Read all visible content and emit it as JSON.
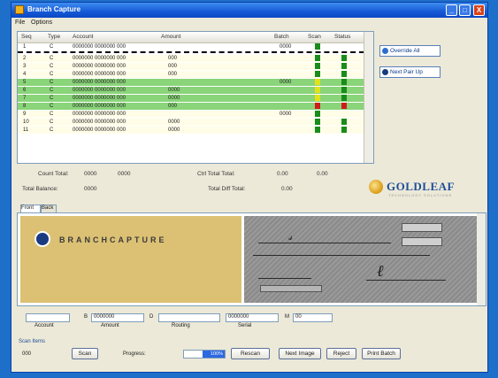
{
  "window": {
    "title": "Branch Capture",
    "controls": {
      "minimize": "_",
      "maximize": "□",
      "close": "X"
    }
  },
  "menu": [
    "File",
    "Options"
  ],
  "grid": {
    "columns": [
      "Seq",
      "Type",
      "Account",
      "Amount",
      "Batch",
      "Scan",
      "Status"
    ],
    "rows": [
      {
        "seq": "1",
        "type": "C",
        "account": "0000000 0000000 000",
        "amount": "",
        "batch": "0000",
        "scan": "green",
        "status": "",
        "bg": "#ffffff",
        "dash_below": true
      },
      {
        "seq": "2",
        "type": "C",
        "account": "0000000 0000000 000",
        "amount": "000",
        "batch": "",
        "scan": "green",
        "status": "green",
        "bg": "#fffde8",
        "dash_below": false
      },
      {
        "seq": "3",
        "type": "C",
        "account": "0000000 0000000 000",
        "amount": "000",
        "batch": "",
        "scan": "green",
        "status": "green",
        "bg": "#fffde8",
        "dash_below": false
      },
      {
        "seq": "4",
        "type": "C",
        "account": "0000000 0000000 000",
        "amount": "000",
        "batch": "",
        "scan": "green",
        "status": "green",
        "bg": "#fffde8",
        "dash_below": false
      },
      {
        "seq": "5",
        "type": "C",
        "account": "0000000 0000000 000",
        "amount": "",
        "batch": "0000",
        "scan": "yellow",
        "status": "green",
        "bg": "#8ad47a",
        "dash_below": false
      },
      {
        "seq": "6",
        "type": "C",
        "account": "0000000 0000000 000",
        "amount": "0000",
        "batch": "",
        "scan": "yellow",
        "status": "green",
        "bg": "#8ad47a",
        "dash_below": false
      },
      {
        "seq": "7",
        "type": "C",
        "account": "0000000 0000000 000",
        "amount": "0000",
        "batch": "",
        "scan": "yellow",
        "status": "green",
        "bg": "#8ad47a",
        "dash_below": false
      },
      {
        "seq": "8",
        "type": "C",
        "account": "0000000 0000000 000",
        "amount": "000",
        "batch": "",
        "scan": "red",
        "status": "red",
        "bg": "#8ad47a",
        "dash_below": false
      },
      {
        "seq": "9",
        "type": "C",
        "account": "0000000 0000000 000",
        "amount": "",
        "batch": "0000",
        "scan": "green",
        "status": "",
        "bg": "#fffde8",
        "dash_below": false
      },
      {
        "seq": "10",
        "type": "C",
        "account": "0000000 0000000 000",
        "amount": "0000",
        "batch": "",
        "scan": "green",
        "status": "green",
        "bg": "#fffde8",
        "dash_below": false
      },
      {
        "seq": "11",
        "type": "C",
        "account": "0000000 0000000 000",
        "amount": "0000",
        "batch": "",
        "scan": "green",
        "status": "green",
        "bg": "#fffde8",
        "dash_below": false
      }
    ]
  },
  "side_buttons": [
    {
      "label": "Override All"
    },
    {
      "label": "Next Pair Up"
    }
  ],
  "summary": {
    "left_label_1": "Count Total:",
    "left_value_1a": "0000",
    "left_value_1b": "0000",
    "left_label_2": "Total Balance:",
    "left_value_2": "0000",
    "mid_label_1": "Ctrl Total Total:",
    "mid_value_1a": "0.00",
    "mid_value_1b": "0.00",
    "mid_label_2": "Total Diff Total:",
    "mid_value_2": "0.00"
  },
  "brand_logo": {
    "name": "GOLDLEAF",
    "tagline": "TECHNOLOGY SOLUTIONS"
  },
  "tabs": [
    "Front",
    "Back"
  ],
  "image_panel": {
    "branch_logo_text": "BRANCHCAPTURE"
  },
  "fields": {
    "f1_value": "",
    "f2_label": "B",
    "f2_value": "0000000",
    "f3_label": "D",
    "f3_value": "",
    "f4_value": "0000000",
    "f5_label": "M",
    "f5_value": "00",
    "sub_labels": [
      "Account",
      "Amount",
      "Routing",
      "Serial"
    ]
  },
  "bottom": {
    "group_label": "Scan Items",
    "count_value": "000",
    "buttons": [
      "Scan",
      "Rescan",
      "Next Image",
      "Reject",
      "Print Batch"
    ],
    "progress_label": "Progress:",
    "progress_value": "100%",
    "progress_fraction": 0.55,
    "progress_color": "#2c68e0"
  },
  "colors": {
    "scan_green": "#1a8c1a",
    "scan_yellow": "#e2e21a",
    "scan_red": "#d11c1c",
    "titlebar": "#1559d6",
    "desktop": "#1e6fc9"
  }
}
